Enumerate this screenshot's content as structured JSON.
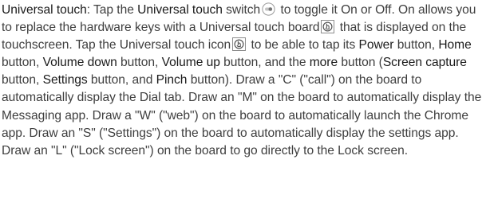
{
  "paragraph": {
    "s01": "Universal touch",
    "s02": ": Tap the ",
    "s03": "Universal touch",
    "s04": " switch",
    "s05": " to toggle it On or Off. On allows you to replace the hardware keys with a Universal touch board",
    "s06": " that is displayed on the touchscreen. Tap the Universal touch icon",
    "s07": " to be able to tap its ",
    "s08": "Power",
    "s09": " button, ",
    "s10": "Home",
    "s11": " button, ",
    "s12": "Volume down",
    "s13": " button, ",
    "s14": "Volume up",
    "s15": " button, and the ",
    "s16": "more",
    "s17": " button (",
    "s18": "Screen capture",
    "s19": " button, ",
    "s20": "Settings",
    "s21": " button, and ",
    "s22": "Pinch",
    "s23": " button). Draw a \"C\" (\"call\") on the board to automatically display the Dial tab. Draw an \"M\" on the board to automatically display the Messaging app. Draw a \"W\" (\"web\") on the board to automatically launch the Chrome app. Draw an \"S\" (\"Settings\") on the board to automatically display the settings app. Draw an \"L\" (\"Lock screen\") on the board to go directly to the Lock screen."
  },
  "icons": {
    "switch": "toggle-switch-icon",
    "board": "universal-touch-icon",
    "board_inline": "universal-touch-icon"
  }
}
